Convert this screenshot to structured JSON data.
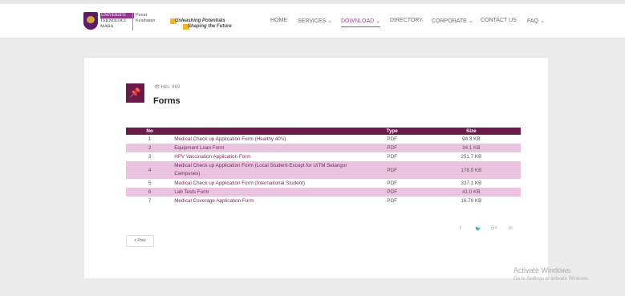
{
  "logo": {
    "line1": "UNIVERSITI",
    "line2": "TEKNOLOGI",
    "line3": "MARA",
    "pusat_line1": "Pusat",
    "pusat_line2": "Kesihatan"
  },
  "tagline": {
    "line1": "Unleashing Potentials",
    "line2": "Shaping the Future"
  },
  "nav": {
    "home": "HOME",
    "services": "SERVICES",
    "download": "DOWNLOAD",
    "directory": "DIRECTORY",
    "corporate": "CORPORATE",
    "contact": "CONTACT US",
    "faq": "FAQ"
  },
  "page": {
    "hits": "Hits: 969",
    "title": "Forms"
  },
  "table": {
    "headers": {
      "no": "No",
      "name": "",
      "type": "Type",
      "size": "Size"
    },
    "rows": [
      {
        "no": "1",
        "name": "Medical Check up Application Form (Healthy 40's)",
        "type": "PDF",
        "size": "94.3 KB"
      },
      {
        "no": "2",
        "name": "Equipment Loan Form",
        "type": "PDF",
        "size": "34.1 KB"
      },
      {
        "no": "3",
        "name": "HPV Vaccination Application Form",
        "type": "PDF",
        "size": "251.7 KB"
      },
      {
        "no": "4",
        "name": "Medical Check up Application Form (Local Student-Except for UiTM Selangor Campuses)",
        "type": "PDF",
        "size": "178.9 KB"
      },
      {
        "no": "5",
        "name": "Medical Check up Application Form (International Student)",
        "type": "PDF",
        "size": "337.1 KB"
      },
      {
        "no": "6",
        "name": "Lab Tests Form",
        "type": "PDF",
        "size": "41.0 KB"
      },
      {
        "no": "7",
        "name": "Medical Coverage Application Form",
        "type": "PDF",
        "size": "16.79 KB"
      }
    ]
  },
  "social": [
    "facebook-icon",
    "twitter-icon",
    "google-plus-icon",
    "linkedin-icon"
  ],
  "pager": {
    "prev": "Prev"
  },
  "watermark": {
    "line1": "Activate Windows",
    "line2": "Go to Settings to activate Windows."
  },
  "colors": {
    "brand": "#6b1a4a",
    "accent": "#b53a95",
    "row_alt": "#eac3de"
  }
}
